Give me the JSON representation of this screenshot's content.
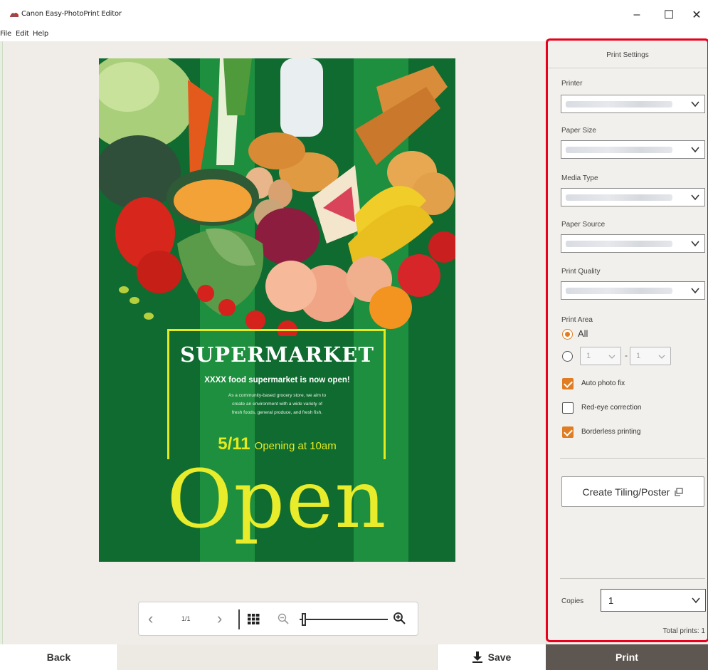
{
  "window": {
    "title": "Canon Easy-PhotoPrint Editor",
    "minimize_glyph": "–",
    "maximize_glyph": "☐",
    "close_glyph": "✕"
  },
  "menu": [
    "File",
    "Edit",
    "Help"
  ],
  "poster": {
    "title": "SUPERMARKET",
    "subtitle": "XXXX food supermarket is now open!",
    "body_lines": [
      "As a community-based grocery store, we aim to",
      "create an environment with a wide variety of",
      "fresh foods, general produce, and fresh fish."
    ],
    "date": "5/11",
    "opening": "Opening at 10am",
    "headline": "Open",
    "colors": {
      "background": "#0f6b2f",
      "stripe": "#1e8f3e",
      "accent": "#e4ea1e"
    }
  },
  "canvas_toolbar": {
    "prev_glyph": "‹",
    "page": "1/1",
    "next_glyph": "›",
    "grid_icon": "grid-icon",
    "zoom_out_icon": "zoom-out-icon",
    "zoom_in_icon": "zoom-in-icon",
    "zoom_level": 0.05
  },
  "print_settings": {
    "header": "Print Settings",
    "fields": {
      "printer": "Printer",
      "paper_size": "Paper Size",
      "media_type": "Media Type",
      "paper_source": "Paper Source",
      "print_quality": "Print Quality"
    },
    "print_area": {
      "label": "Print Area",
      "all_label": "All",
      "range_from": "1",
      "range_to": "1",
      "range_dash": "-",
      "selected": "all"
    },
    "options": {
      "auto_photo_fix": {
        "label": "Auto photo fix",
        "checked": true
      },
      "red_eye": {
        "label": "Red-eye correction",
        "checked": false
      },
      "borderless": {
        "label": "Borderless printing",
        "checked": true
      }
    },
    "tiling_button": "Create Tiling/Poster",
    "copies_label": "Copies",
    "copies_value": "1",
    "total_prints": "Total prints: 1",
    "accent_color": "#e07c22",
    "highlight_color": "#e8001c"
  },
  "actions": {
    "back": "Back",
    "save": "Save",
    "print": "Print"
  }
}
